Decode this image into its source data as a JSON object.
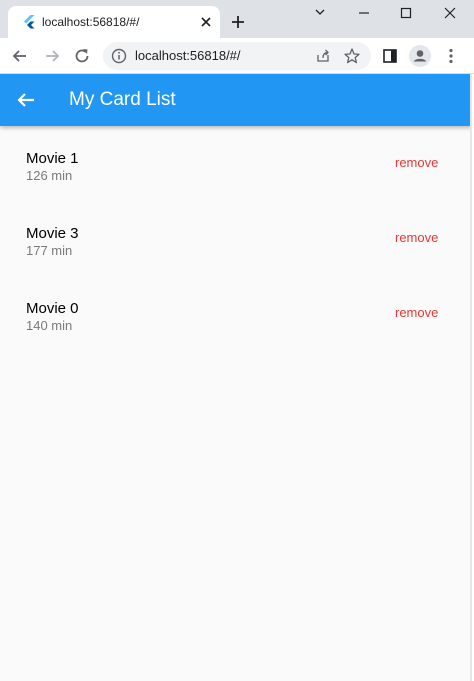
{
  "browser": {
    "tab_title": "localhost:56818/#/",
    "url": "localhost:56818/#/",
    "icons": [
      "flutter-favicon-icon",
      "close-icon",
      "plus-icon",
      "chevron-down-icon",
      "minimize-icon",
      "maximize-icon",
      "window-close-icon",
      "back-arrow-icon",
      "forward-arrow-icon",
      "reload-icon",
      "info-icon",
      "share-icon",
      "star-icon",
      "sidebar-icon",
      "profile-icon",
      "more-icon"
    ]
  },
  "app": {
    "title": "My Card List",
    "accent_color": "#2196f3",
    "remove_color": "#e53935",
    "items": [
      {
        "title": "Movie 1",
        "subtitle": "126 min",
        "action": "remove"
      },
      {
        "title": "Movie 3",
        "subtitle": "177 min",
        "action": "remove"
      },
      {
        "title": "Movie 0",
        "subtitle": "140 min",
        "action": "remove"
      }
    ]
  }
}
